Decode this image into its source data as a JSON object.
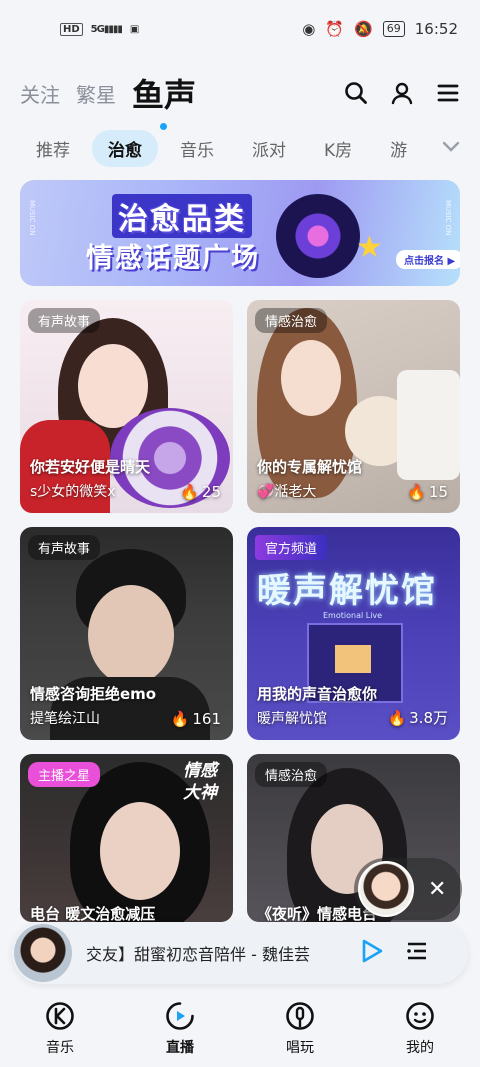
{
  "status_bar": {
    "left_labels": [
      "HD",
      "5G"
    ],
    "time": "16:52",
    "battery": "69"
  },
  "top_nav": {
    "tabs": [
      {
        "label": "关注"
      },
      {
        "label": "繁星"
      },
      {
        "label": "鱼声",
        "active": true
      }
    ],
    "icons": [
      "search-icon",
      "user-icon",
      "menu-icon"
    ]
  },
  "categories": {
    "items": [
      "推荐",
      "治愈",
      "音乐",
      "派对",
      "K房",
      "游"
    ],
    "active_index": 1
  },
  "banner": {
    "title_line1": "治愈品类",
    "title_line2": "情感话题广场",
    "button_label": "点击报名",
    "side_text_left": "MUSIC ON",
    "side_text_right": "MUSIC ON"
  },
  "cards": [
    {
      "tag": "有声故事",
      "title": "你若安好便是晴天",
      "author": "s少女的微笑x",
      "heat": "25"
    },
    {
      "tag": "情感治愈",
      "title": "你的专属解忧馆",
      "author": "💞湉老大",
      "heat": "15"
    },
    {
      "tag": "有声故事",
      "title": "情感咨询拒绝emo",
      "author": "提笔绘江山",
      "heat": "161"
    },
    {
      "tag": "官方频道",
      "title": "用我的声音治愈你",
      "author": "暖声解忧馆",
      "heat": "3.8万",
      "art_text": "暖声解忧馆",
      "art_sub": "Emotional Live"
    },
    {
      "tag": "主播之星",
      "title": "电台 暖文治愈减压",
      "author": "",
      "heat": "",
      "art_text": "情感大神"
    },
    {
      "tag": "情感治愈",
      "title": "《夜听》情感电台",
      "author": "",
      "heat": ""
    }
  ],
  "player": {
    "title": "交友】甜蜜初恋音陪伴 - 魏佳芸"
  },
  "bottom_nav": {
    "items": [
      {
        "label": "音乐",
        "icon": "music-k-icon"
      },
      {
        "label": "直播",
        "icon": "live-icon",
        "active": true
      },
      {
        "label": "唱玩",
        "icon": "mic-icon"
      },
      {
        "label": "我的",
        "icon": "profile-icon"
      }
    ]
  },
  "colors": {
    "accent": "#1aa3f5",
    "category_active_bg": "#d7ecfb",
    "page_bg": "#f3f5f8"
  }
}
